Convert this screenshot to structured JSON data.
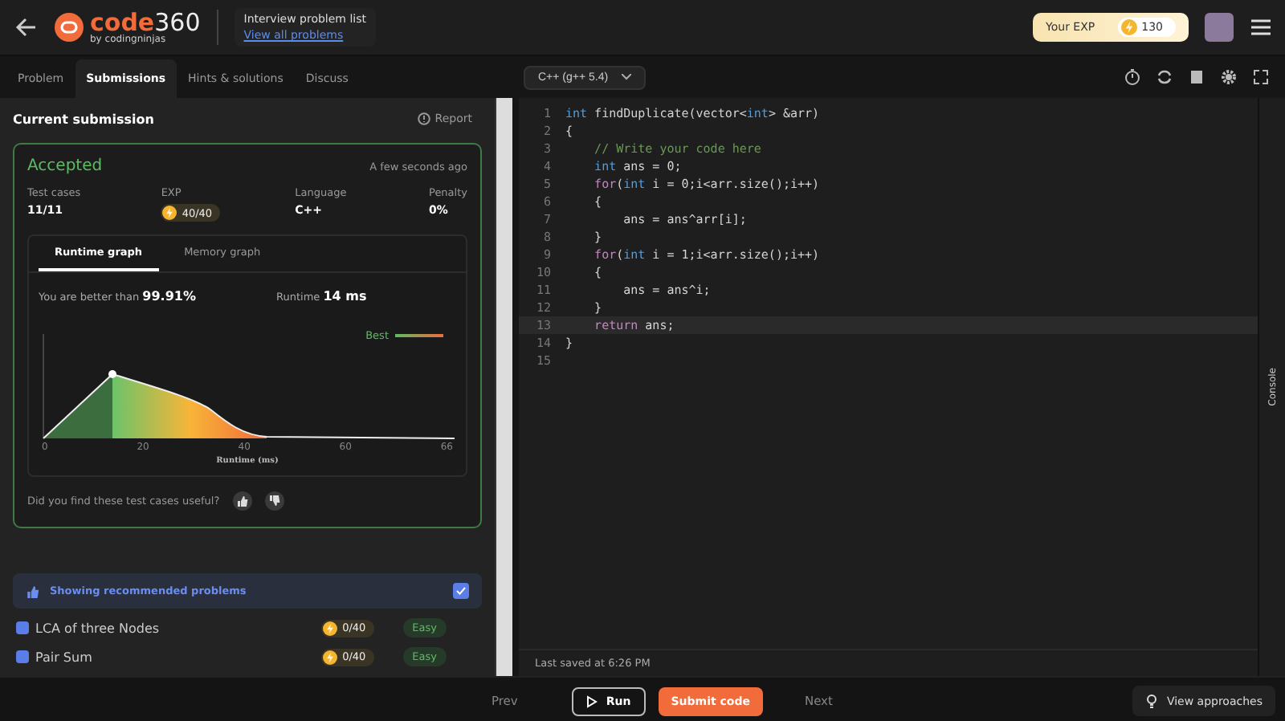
{
  "header": {
    "logo_word": "code",
    "logo_num": "360",
    "logo_sub": "by codingninjas",
    "list_title": "Interview problem list",
    "list_link": "View all problems",
    "exp_label": "Your EXP",
    "exp_value": "130"
  },
  "tabs": [
    {
      "label": "Problem",
      "selected": false
    },
    {
      "label": "Submissions",
      "selected": true
    },
    {
      "label": "Hints & solutions",
      "selected": false
    },
    {
      "label": "Discuss",
      "selected": false
    }
  ],
  "language": "C++ (g++ 5.4)",
  "submission": {
    "title": "Current submission",
    "report": "Report",
    "status": "Accepted",
    "time": "A few seconds ago",
    "stats": [
      {
        "label": "Test cases",
        "value": "11/11",
        "kind": "text"
      },
      {
        "label": "EXP",
        "value": "40/40",
        "kind": "exp"
      },
      {
        "label": "Language",
        "value": "C++",
        "kind": "text"
      },
      {
        "label": "Penalty",
        "value": "0%",
        "kind": "text"
      }
    ],
    "graph_tabs": [
      {
        "label": "Runtime graph",
        "selected": true
      },
      {
        "label": "Memory graph",
        "selected": false
      }
    ],
    "better_label": "You are better than",
    "better_value": "99.91%",
    "runtime_label": "Runtime",
    "runtime_value": "14 ms",
    "legend": "Best",
    "x_labels": [
      "0",
      "20",
      "40",
      "60",
      "66"
    ],
    "axis_title": "Runtime (ms)",
    "feedback": "Did you find these test cases useful?"
  },
  "recommended": {
    "label": "Showing recommended problems",
    "checked": true,
    "problems": [
      {
        "title": "LCA of three Nodes",
        "exp": "0/40",
        "difficulty": "Easy"
      },
      {
        "title": "Pair Sum",
        "exp": "0/40",
        "difficulty": "Easy"
      }
    ]
  },
  "code_lines": [
    {
      "current": false,
      "tokens": [
        {
          "kind": "type",
          "text": "int"
        },
        {
          "kind": "plain",
          "text": " findDuplicate(vector<"
        },
        {
          "kind": "type",
          "text": "int"
        },
        {
          "kind": "plain",
          "text": "> &arr)"
        }
      ]
    },
    {
      "current": false,
      "tokens": [
        {
          "kind": "plain",
          "text": "{"
        }
      ]
    },
    {
      "current": false,
      "tokens": [
        {
          "kind": "comment",
          "text": "    // Write your code here"
        }
      ]
    },
    {
      "current": false,
      "tokens": [
        {
          "kind": "type",
          "text": "    int"
        },
        {
          "kind": "plain",
          "text": " ans = 0;"
        }
      ]
    },
    {
      "current": false,
      "tokens": [
        {
          "kind": "control",
          "text": "    for"
        },
        {
          "kind": "plain",
          "text": "("
        },
        {
          "kind": "type",
          "text": "int"
        },
        {
          "kind": "plain",
          "text": " i = 0;i<arr.size();i++)"
        }
      ]
    },
    {
      "current": false,
      "tokens": [
        {
          "kind": "plain",
          "text": "    {"
        }
      ]
    },
    {
      "current": false,
      "tokens": [
        {
          "kind": "plain",
          "text": "        ans = ans^arr[i];"
        }
      ]
    },
    {
      "current": false,
      "tokens": [
        {
          "kind": "plain",
          "text": "    }"
        }
      ]
    },
    {
      "current": false,
      "tokens": [
        {
          "kind": "control",
          "text": "    for"
        },
        {
          "kind": "plain",
          "text": "("
        },
        {
          "kind": "type",
          "text": "int"
        },
        {
          "kind": "plain",
          "text": " i = 1;i<arr.size();i++)"
        }
      ]
    },
    {
      "current": false,
      "tokens": [
        {
          "kind": "plain",
          "text": "    {"
        }
      ]
    },
    {
      "current": false,
      "tokens": [
        {
          "kind": "plain",
          "text": "        ans = ans^i;"
        }
      ]
    },
    {
      "current": false,
      "tokens": [
        {
          "kind": "plain",
          "text": "    }"
        }
      ]
    },
    {
      "current": true,
      "tokens": [
        {
          "kind": "control",
          "text": "    return"
        },
        {
          "kind": "plain",
          "text": " ans;"
        }
      ]
    },
    {
      "current": false,
      "tokens": [
        {
          "kind": "plain",
          "text": "}"
        }
      ]
    },
    {
      "current": false
    }
  ],
  "line_numbers": [
    "1",
    "2",
    "3",
    "4",
    "5",
    "6",
    "7",
    "8",
    "9",
    "10",
    "11",
    "12",
    "13",
    "14",
    "15"
  ],
  "saved": "Last saved at 6:26 PM",
  "console": "Console",
  "footer": {
    "prev": "Prev",
    "run": "Run",
    "submit": "Submit code",
    "next": "Next",
    "approaches": "View approaches"
  }
}
